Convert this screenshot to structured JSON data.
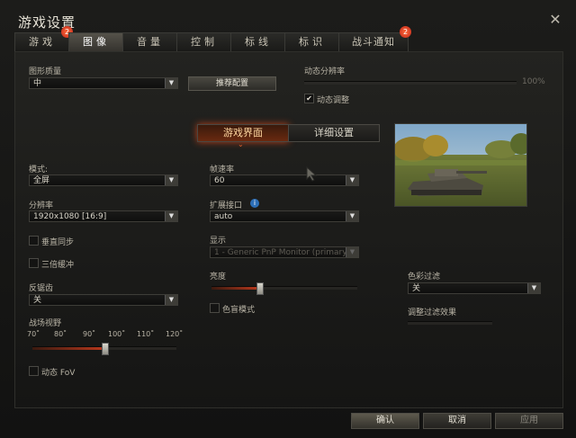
{
  "window": {
    "title": "游戏设置"
  },
  "tabs": [
    {
      "label": "游戏",
      "badge": "2"
    },
    {
      "label": "图像",
      "active": true
    },
    {
      "label": "音量"
    },
    {
      "label": "控制"
    },
    {
      "label": "标线"
    },
    {
      "label": "标识"
    },
    {
      "label": "战斗通知",
      "badge": "2"
    }
  ],
  "graphics_quality": {
    "label": "图形质量",
    "value": "中",
    "recommend_button": "推荐配置"
  },
  "dynamic_resolution": {
    "label": "动态分辨率",
    "percent": "100%",
    "value": 1.0,
    "checkbox_label": "动态调整",
    "checked": true
  },
  "subtabs": [
    {
      "label": "游戏界面",
      "active": true
    },
    {
      "label": "详细设置"
    }
  ],
  "left": {
    "mode": {
      "label": "模式:",
      "value": "全屏"
    },
    "resolution": {
      "label": "分辨率",
      "value": "1920x1080 [16:9]"
    },
    "vsync": {
      "label": "垂直同步",
      "checked": false
    },
    "triple_buffer": {
      "label": "三倍缓冲",
      "checked": false
    },
    "antialias": {
      "label": "反锯齿",
      "value": "关"
    },
    "fov": {
      "label": "战场视野",
      "ticks": [
        "70˚",
        "80˚",
        "90˚",
        "100˚",
        "110˚",
        "120˚"
      ],
      "value_deg": 95
    },
    "dynamic_fov": {
      "label": "动态 FoV",
      "checked": false
    }
  },
  "middle": {
    "framerate": {
      "label": "帧速率",
      "value": "60"
    },
    "extension": {
      "label": "扩展接口",
      "value": "auto",
      "info_icon": "info-icon"
    },
    "display": {
      "label": "显示",
      "value": "1 - Generic PnP Monitor (primary)"
    },
    "brightness": {
      "label": "亮度",
      "value": 0.5
    },
    "colorblind": {
      "label": "色盲模式",
      "checked": false
    }
  },
  "right": {
    "color_filter": {
      "label": "色彩过滤",
      "value": "关"
    },
    "filter_effect": {
      "label": "调整过滤效果"
    }
  },
  "footer": {
    "ok": "确认",
    "cancel": "取消",
    "apply": "应用"
  }
}
